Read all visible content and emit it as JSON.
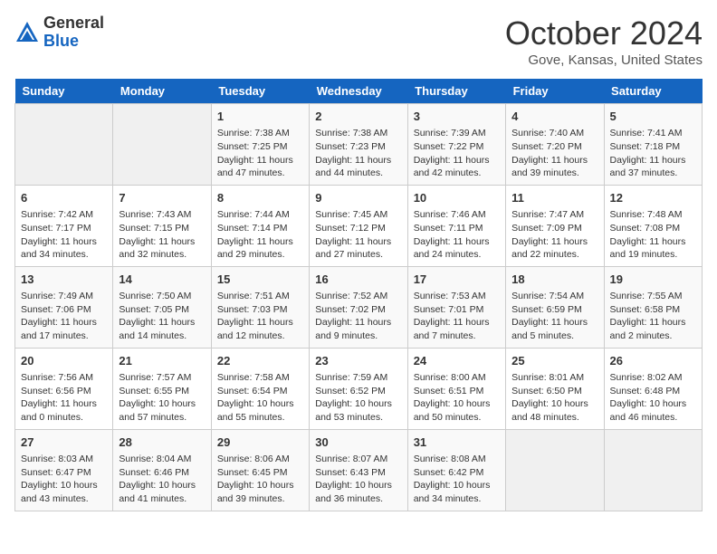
{
  "header": {
    "logo_line1": "General",
    "logo_line2": "Blue",
    "month_title": "October 2024",
    "location": "Gove, Kansas, United States"
  },
  "days_of_week": [
    "Sunday",
    "Monday",
    "Tuesday",
    "Wednesday",
    "Thursday",
    "Friday",
    "Saturday"
  ],
  "weeks": [
    [
      {
        "day": "",
        "info": ""
      },
      {
        "day": "",
        "info": ""
      },
      {
        "day": "1",
        "info": "Sunrise: 7:38 AM\nSunset: 7:25 PM\nDaylight: 11 hours and 47 minutes."
      },
      {
        "day": "2",
        "info": "Sunrise: 7:38 AM\nSunset: 7:23 PM\nDaylight: 11 hours and 44 minutes."
      },
      {
        "day": "3",
        "info": "Sunrise: 7:39 AM\nSunset: 7:22 PM\nDaylight: 11 hours and 42 minutes."
      },
      {
        "day": "4",
        "info": "Sunrise: 7:40 AM\nSunset: 7:20 PM\nDaylight: 11 hours and 39 minutes."
      },
      {
        "day": "5",
        "info": "Sunrise: 7:41 AM\nSunset: 7:18 PM\nDaylight: 11 hours and 37 minutes."
      }
    ],
    [
      {
        "day": "6",
        "info": "Sunrise: 7:42 AM\nSunset: 7:17 PM\nDaylight: 11 hours and 34 minutes."
      },
      {
        "day": "7",
        "info": "Sunrise: 7:43 AM\nSunset: 7:15 PM\nDaylight: 11 hours and 32 minutes."
      },
      {
        "day": "8",
        "info": "Sunrise: 7:44 AM\nSunset: 7:14 PM\nDaylight: 11 hours and 29 minutes."
      },
      {
        "day": "9",
        "info": "Sunrise: 7:45 AM\nSunset: 7:12 PM\nDaylight: 11 hours and 27 minutes."
      },
      {
        "day": "10",
        "info": "Sunrise: 7:46 AM\nSunset: 7:11 PM\nDaylight: 11 hours and 24 minutes."
      },
      {
        "day": "11",
        "info": "Sunrise: 7:47 AM\nSunset: 7:09 PM\nDaylight: 11 hours and 22 minutes."
      },
      {
        "day": "12",
        "info": "Sunrise: 7:48 AM\nSunset: 7:08 PM\nDaylight: 11 hours and 19 minutes."
      }
    ],
    [
      {
        "day": "13",
        "info": "Sunrise: 7:49 AM\nSunset: 7:06 PM\nDaylight: 11 hours and 17 minutes."
      },
      {
        "day": "14",
        "info": "Sunrise: 7:50 AM\nSunset: 7:05 PM\nDaylight: 11 hours and 14 minutes."
      },
      {
        "day": "15",
        "info": "Sunrise: 7:51 AM\nSunset: 7:03 PM\nDaylight: 11 hours and 12 minutes."
      },
      {
        "day": "16",
        "info": "Sunrise: 7:52 AM\nSunset: 7:02 PM\nDaylight: 11 hours and 9 minutes."
      },
      {
        "day": "17",
        "info": "Sunrise: 7:53 AM\nSunset: 7:01 PM\nDaylight: 11 hours and 7 minutes."
      },
      {
        "day": "18",
        "info": "Sunrise: 7:54 AM\nSunset: 6:59 PM\nDaylight: 11 hours and 5 minutes."
      },
      {
        "day": "19",
        "info": "Sunrise: 7:55 AM\nSunset: 6:58 PM\nDaylight: 11 hours and 2 minutes."
      }
    ],
    [
      {
        "day": "20",
        "info": "Sunrise: 7:56 AM\nSunset: 6:56 PM\nDaylight: 11 hours and 0 minutes."
      },
      {
        "day": "21",
        "info": "Sunrise: 7:57 AM\nSunset: 6:55 PM\nDaylight: 10 hours and 57 minutes."
      },
      {
        "day": "22",
        "info": "Sunrise: 7:58 AM\nSunset: 6:54 PM\nDaylight: 10 hours and 55 minutes."
      },
      {
        "day": "23",
        "info": "Sunrise: 7:59 AM\nSunset: 6:52 PM\nDaylight: 10 hours and 53 minutes."
      },
      {
        "day": "24",
        "info": "Sunrise: 8:00 AM\nSunset: 6:51 PM\nDaylight: 10 hours and 50 minutes."
      },
      {
        "day": "25",
        "info": "Sunrise: 8:01 AM\nSunset: 6:50 PM\nDaylight: 10 hours and 48 minutes."
      },
      {
        "day": "26",
        "info": "Sunrise: 8:02 AM\nSunset: 6:48 PM\nDaylight: 10 hours and 46 minutes."
      }
    ],
    [
      {
        "day": "27",
        "info": "Sunrise: 8:03 AM\nSunset: 6:47 PM\nDaylight: 10 hours and 43 minutes."
      },
      {
        "day": "28",
        "info": "Sunrise: 8:04 AM\nSunset: 6:46 PM\nDaylight: 10 hours and 41 minutes."
      },
      {
        "day": "29",
        "info": "Sunrise: 8:06 AM\nSunset: 6:45 PM\nDaylight: 10 hours and 39 minutes."
      },
      {
        "day": "30",
        "info": "Sunrise: 8:07 AM\nSunset: 6:43 PM\nDaylight: 10 hours and 36 minutes."
      },
      {
        "day": "31",
        "info": "Sunrise: 8:08 AM\nSunset: 6:42 PM\nDaylight: 10 hours and 34 minutes."
      },
      {
        "day": "",
        "info": ""
      },
      {
        "day": "",
        "info": ""
      }
    ]
  ]
}
